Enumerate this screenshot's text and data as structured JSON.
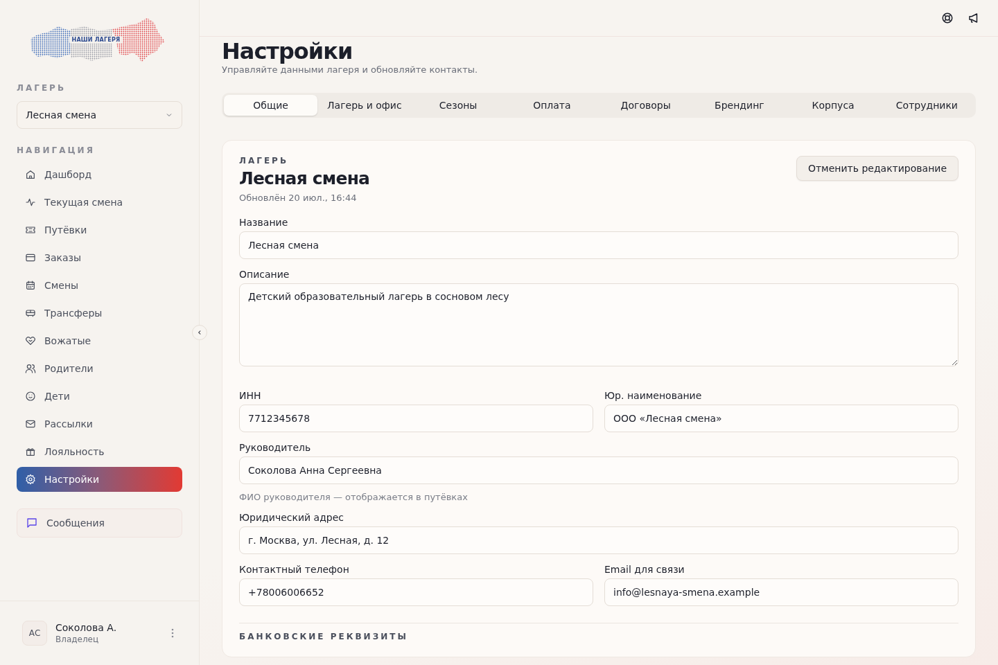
{
  "logo": {
    "text": "НАШИ ЛАГЕРЯ"
  },
  "sidebar": {
    "camp_label": "ЛАГЕРЬ",
    "camp_select": {
      "value": "Лесная смена"
    },
    "nav_label": "НАВИГАЦИЯ",
    "items": [
      {
        "label": "Дашборд",
        "selected": false
      },
      {
        "label": "Текущая смена",
        "selected": false
      },
      {
        "label": "Путёвки",
        "selected": false
      },
      {
        "label": "Заказы",
        "selected": false
      },
      {
        "label": "Смены",
        "selected": false
      },
      {
        "label": "Трансферы",
        "selected": false
      },
      {
        "label": "Вожатые",
        "selected": false
      },
      {
        "label": "Родители",
        "selected": false
      },
      {
        "label": "Дети",
        "selected": false
      },
      {
        "label": "Рассылки",
        "selected": false
      },
      {
        "label": "Лояльность",
        "selected": false
      },
      {
        "label": "Настройки",
        "selected": true
      }
    ],
    "messages": {
      "label": "Сообщения"
    },
    "user": {
      "initials": "АС",
      "name": "Соколова А.",
      "role": "Владелец"
    }
  },
  "page": {
    "title": "Настройки",
    "subtitle": "Управляйте данными лагеря и обновляйте контакты."
  },
  "tabs": [
    {
      "label": "Общие",
      "selected": true
    },
    {
      "label": "Лагерь и офис",
      "selected": false
    },
    {
      "label": "Сезоны",
      "selected": false
    },
    {
      "label": "Оплата",
      "selected": false
    },
    {
      "label": "Договоры",
      "selected": false
    },
    {
      "label": "Брендинг",
      "selected": false
    },
    {
      "label": "Корпуса",
      "selected": false
    },
    {
      "label": "Сотрудники",
      "selected": false
    }
  ],
  "card": {
    "eyebrow": "ЛАГЕРЬ",
    "title": "Лесная смена",
    "updated": "Обновлён 20 июл., 16:44",
    "cancel_button": "Отменить редактирование",
    "rows": [
      {
        "fields": [
          {
            "kind": "input",
            "label": "Название",
            "value": "Лесная смена"
          }
        ]
      },
      {
        "fields": [
          {
            "kind": "textarea",
            "label": "Описание",
            "value": "Детский образовательный лагерь в сосновом лесу"
          }
        ]
      },
      {
        "fields": [
          {
            "kind": "input",
            "label": "ИНН",
            "value": "7712345678"
          },
          {
            "kind": "input",
            "label": "Юр. наименование",
            "value": "ООО «Лесная смена»"
          }
        ]
      },
      {
        "fields": [
          {
            "kind": "input",
            "label": "Руководитель",
            "value": "Соколова Анна Сергеевна",
            "hint": "ФИО руководителя — отображается в путёвках"
          }
        ]
      },
      {
        "fields": [
          {
            "kind": "input",
            "label": "Юридический адрес",
            "value": "г. Москва, ул. Лесная, д. 12"
          }
        ]
      },
      {
        "fields": [
          {
            "kind": "input",
            "label": "Контактный телефон",
            "value": "+78006006652"
          },
          {
            "kind": "input",
            "label": "Email для связи",
            "value": "info@lesnaya-smena.example"
          }
        ]
      }
    ],
    "section_heading": "БАНКОВСКИЕ РЕКВИЗИТЫ"
  }
}
